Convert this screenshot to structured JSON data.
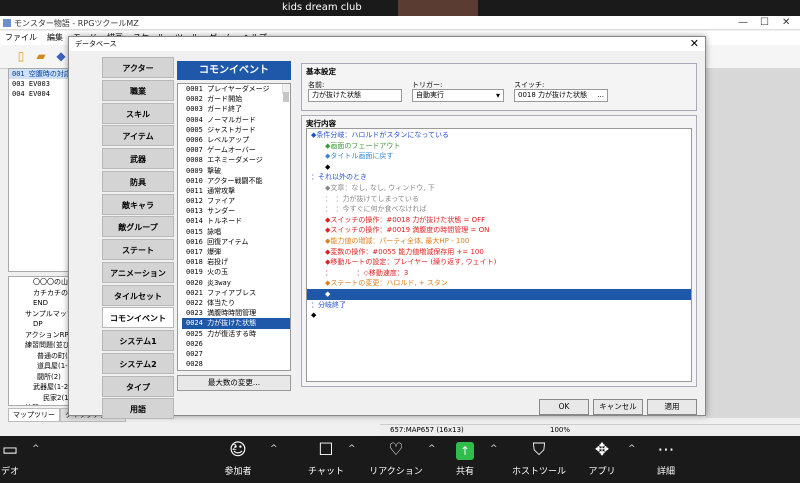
{
  "zoom_top": {
    "participant_name": "kids dream club"
  },
  "editor": {
    "title": "モンスター物語 - RPGツクールMZ",
    "menu": [
      "ファイル",
      "編集",
      "モード",
      "描画",
      "スケール",
      "ツール",
      "ゲーム",
      "ヘルプ"
    ],
    "map_list": [
      {
        "label": "001 空腹時の対応",
        "selected": true
      },
      {
        "label": "003 EV003",
        "selected": false
      },
      {
        "label": "004 EV004",
        "selected": false
      }
    ],
    "tree": [
      "〇〇〇の山(右手)",
      "カチカチの山(右)",
      "END",
      "サンプルマップブラ",
      "DP",
      "アクションRPG用サン",
      "練習問題(並び替え)",
      "普通の町(1)",
      "道具屋(1-1)",
      "闘所(2)",
      "武器屋(1-2)",
      "民家2(1-3)",
      "練習"
    ],
    "tree_tabs": [
      "マップツリー",
      "クイックアクセス"
    ],
    "status": {
      "map": "657:MAP657 (16x13)",
      "zoom": "100%"
    }
  },
  "db": {
    "title": "データベース",
    "tabs": [
      {
        "label": "アクター"
      },
      {
        "label": "職業"
      },
      {
        "label": "スキル"
      },
      {
        "label": "アイテム"
      },
      {
        "label": "武器"
      },
      {
        "label": "防具"
      },
      {
        "label": "敵キャラ"
      },
      {
        "label": "敵グループ"
      },
      {
        "label": "ステート"
      },
      {
        "label": "アニメーション"
      },
      {
        "label": "タイルセット"
      },
      {
        "label": "コモンイベント"
      },
      {
        "label": "システム1"
      },
      {
        "label": "システム2"
      },
      {
        "label": "タイプ"
      },
      {
        "label": "用語"
      }
    ],
    "active_tab": "コモンイベント",
    "list_header": "コモンイベント",
    "events": [
      "0001 プレイヤーダメージ",
      "0002 ガード開始",
      "0003 ガード終了",
      "0004 ノーマルガード",
      "0005 ジャストガード",
      "0006 レベルアップ",
      "0007 ゲームオーバー",
      "0008 エネミーダメージ",
      "0009 撃破",
      "0010 アクター戦闘不能",
      "0011 通常攻撃",
      "0012 ファイア",
      "0013 サンダー",
      "0014 トルネード",
      "0015 詠唱",
      "0016 回復アイテム",
      "0017 爆弾",
      "0018 岩投げ",
      "0019 火の玉",
      "0020 炎3way",
      "0021 ファイアブレス",
      "0022 体当たり",
      "0023 満腹時時間管理",
      "0024 力が抜けた状態",
      "0025 力が復活する時",
      "0026",
      "0027",
      "0028"
    ],
    "selected_event": "0024 力が抜けた状態",
    "max_button": "最大数の変更...",
    "basic": {
      "section_title": "基本設定",
      "name_label": "名前:",
      "name_value": "力が抜けた状態",
      "trigger_label": "トリガー:",
      "trigger_value": "自動実行",
      "switch_label": "スイッチ:",
      "switch_value": "0018 力が抜けた状態",
      "switch_button": "..."
    },
    "content_title": "実行内容",
    "commands": [
      {
        "text": "◆条件分岐：ハロルドがスタンになっている",
        "color": "c-blue",
        "indent": 0
      },
      {
        "text": "◆画面のフェードアウト",
        "color": "c-green",
        "indent": 1
      },
      {
        "text": "◆タイトル画面に戻す",
        "color": "c-lblue",
        "indent": 1
      },
      {
        "text": "◆",
        "color": "",
        "indent": 1
      },
      {
        "text": "：それ以外のとき",
        "color": "c-blue",
        "indent": 0
      },
      {
        "text": "◆文章：なし, なし, ウィンドウ, 下",
        "color": "c-gray",
        "indent": 1
      },
      {
        "text": "：　：力が抜けてしまっている",
        "color": "c-gray",
        "indent": 1
      },
      {
        "text": "：　：今すぐに何か食べなければ",
        "color": "c-gray",
        "indent": 1
      },
      {
        "text": "◆スイッチの操作：#0018 力が抜けた状態 = OFF",
        "color": "c-red",
        "indent": 1
      },
      {
        "text": "◆スイッチの操作：#0019 満腹度の時間管理 = ON",
        "color": "c-red",
        "indent": 1
      },
      {
        "text": "◆能力値の増減：パーティ全体, 最大HP - 100",
        "color": "c-orange",
        "indent": 1
      },
      {
        "text": "◆変数の操作：#0055 能力値増減保存用 += 100",
        "color": "c-red",
        "indent": 1
      },
      {
        "text": "◆移動ルートの設定：プレイヤー (繰り返す, ウェイト)",
        "color": "c-red",
        "indent": 1
      },
      {
        "text": "：　　　　：◇移動速度：3",
        "color": "c-red",
        "indent": 1
      },
      {
        "text": "◆ステートの変更：ハロルド, + スタン",
        "color": "c-orange",
        "indent": 1
      },
      {
        "text": "◆",
        "color": "",
        "indent": 1,
        "selected": true
      },
      {
        "text": "：分岐終了",
        "color": "c-blue",
        "indent": 0
      },
      {
        "text": "◆",
        "color": "",
        "indent": 0
      }
    ],
    "buttons": {
      "ok": "OK",
      "cancel": "キャンセル",
      "apply": "適用"
    }
  },
  "zoom_bar": {
    "items": [
      {
        "label": "デオ",
        "icon": "video-icon"
      },
      {
        "label": "参加者",
        "icon": "participants-icon",
        "count": "2"
      },
      {
        "label": "チャット",
        "icon": "chat-icon"
      },
      {
        "label": "リアクション",
        "icon": "reaction-icon"
      },
      {
        "label": "共有",
        "icon": "share-icon"
      },
      {
        "label": "ホストツール",
        "icon": "host-tools-icon"
      },
      {
        "label": "アプリ",
        "icon": "apps-icon"
      },
      {
        "label": "詳細",
        "icon": "more-icon"
      }
    ]
  }
}
